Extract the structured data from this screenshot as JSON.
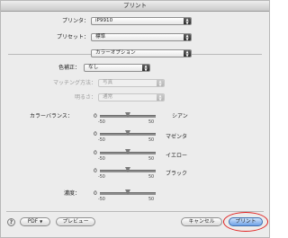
{
  "window": {
    "title": "プリント"
  },
  "printer": {
    "label": "プリンタ：",
    "value": "iP9910"
  },
  "preset": {
    "label": "プリセット：",
    "value": "標準"
  },
  "pane": {
    "value": "カラーオプション"
  },
  "color_correction": {
    "label": "色補正：",
    "value": "なし"
  },
  "matching": {
    "label": "マッチング方法：",
    "value": "写真"
  },
  "brightness": {
    "label": "明るさ：",
    "value": "通常"
  },
  "color_balance": {
    "label": "カラーバランス：",
    "sliders": [
      {
        "zero": "0",
        "min": "-50",
        "max": "50",
        "name": "シアン",
        "value": 0
      },
      {
        "zero": "0",
        "min": "-50",
        "max": "50",
        "name": "マゼンタ",
        "value": 0
      },
      {
        "zero": "0",
        "min": "-50",
        "max": "50",
        "name": "イエロー",
        "value": 0
      },
      {
        "zero": "0",
        "min": "-50",
        "max": "50",
        "name": "ブラック",
        "value": 0
      }
    ]
  },
  "density": {
    "label": "濃度：",
    "zero": "0",
    "min": "-50",
    "max": "50",
    "value": 0
  },
  "footer": {
    "help": "?",
    "pdf": "PDF",
    "preview": "プレビュー",
    "cancel": "キャンセル",
    "print": "プリント"
  },
  "colors": {
    "highlight_ring": "#e0201f",
    "default_button": "#6fa2e6"
  }
}
